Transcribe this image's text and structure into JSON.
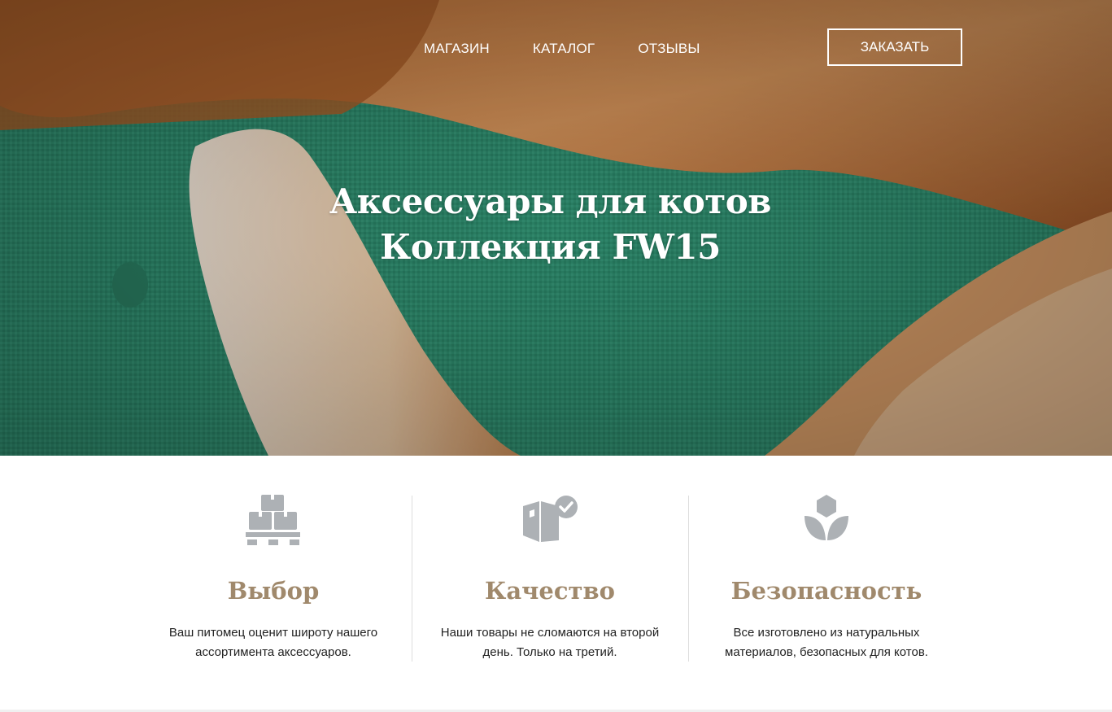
{
  "nav": {
    "items": [
      "МАГАЗИН",
      "КАТАЛОГ",
      "ОТЗЫВЫ"
    ],
    "order_button": "ЗАКАЗАТЬ"
  },
  "hero": {
    "title_line1": "Аксессуары для котов",
    "title_line2": "Коллекция FW15"
  },
  "features": [
    {
      "icon": "boxes-pallet-icon",
      "title": "Выбор",
      "desc": "Ваш питомец оценит широту нашего ассортимента аксессуаров."
    },
    {
      "icon": "box-check-icon",
      "title": "Качество",
      "desc": "Наши товары не сломаются на второй день. Только на третий."
    },
    {
      "icon": "lotus-leaf-icon",
      "title": "Безопасность",
      "desc": "Все изготовлено из натуральных материалов, безопасных для котов."
    }
  ],
  "colors": {
    "feature_title": "#a0896c",
    "icon": "#adb1b5",
    "cushion": "#2f8a6e",
    "fur": "#c27a3e"
  }
}
